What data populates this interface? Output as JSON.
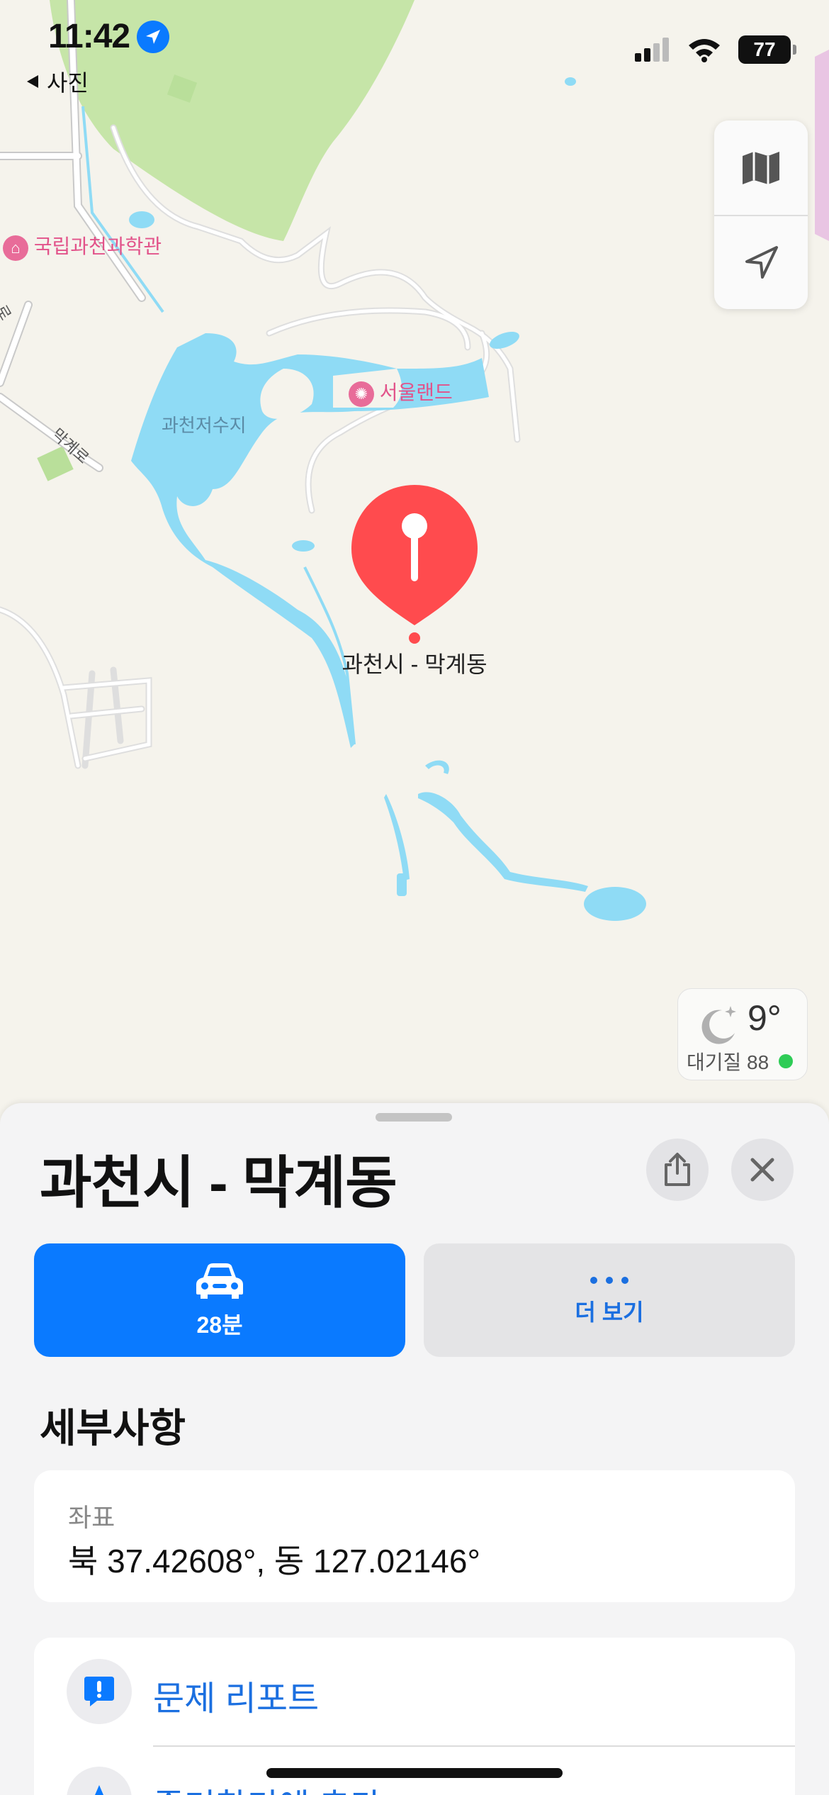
{
  "status_bar": {
    "time": "11:42",
    "back_label": "사진",
    "battery": "77",
    "icons": [
      "location-arrow-icon",
      "signal-icon",
      "wifi-icon",
      "battery-icon"
    ]
  },
  "map": {
    "labels": {
      "museum": "국립과천과학관",
      "seoulland": "서울랜드",
      "reservoir": "과천저수지",
      "road": "막계로",
      "road_edge": "로"
    },
    "pin_label": "과천시 - 막계동",
    "controls": [
      "map-mode-icon",
      "location-arrow-icon"
    ],
    "weather": {
      "temp": "9°",
      "aqi_label": "대기질 88",
      "icon": "moon-stars-icon",
      "aqi_color": "#2ecc56"
    },
    "colors": {
      "land": "#f5f3ec",
      "park": "#c6e5a8",
      "water": "#8fdbf5",
      "pin": "#ff4b4e",
      "poi": "#e2538a"
    }
  },
  "sheet": {
    "title": "과천시 - 막계동",
    "buttons": {
      "drive_label": "28분",
      "more_label": "더 보기"
    },
    "details_title": "세부사항",
    "coordinates": {
      "key": "좌표",
      "value": "북 37.42608°, 동 127.02146°"
    },
    "links": [
      {
        "label": "문제 리포트",
        "icon": "report-bubble-icon"
      },
      {
        "label": "즐겨찾기에 추가",
        "icon": "star-icon"
      }
    ],
    "accent": "#0a7aff"
  }
}
